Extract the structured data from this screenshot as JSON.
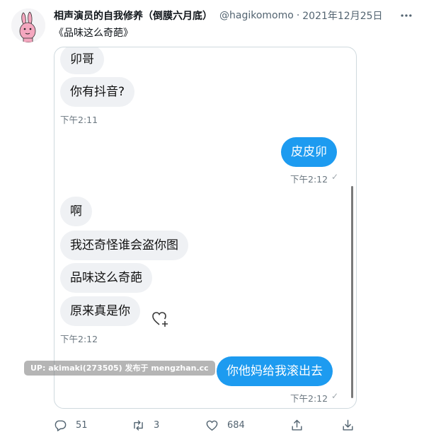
{
  "author": {
    "display_name": "相声演员的自我修养（倒膜六月底）",
    "handle": "@hagikomomo",
    "separator": "·",
    "date": "2021年12月25日"
  },
  "tweet": {
    "text": "《品味这么奇葩》"
  },
  "chat": {
    "messages": [
      {
        "direction": "in",
        "text": "卯哥"
      },
      {
        "direction": "in",
        "text": "你有抖音?"
      },
      {
        "type": "time",
        "text": "下午2:11"
      },
      {
        "direction": "out",
        "text": "皮皮卯"
      },
      {
        "type": "time",
        "text": "下午2:12",
        "read_mark": "✓"
      },
      {
        "direction": "in",
        "text": "啊"
      },
      {
        "direction": "in",
        "text": "我还奇怪谁会盗你图"
      },
      {
        "direction": "in",
        "text": "品味这么奇葩"
      },
      {
        "direction": "in",
        "text": "原来真是你"
      },
      {
        "type": "time",
        "text": "下午2:12"
      },
      {
        "direction": "out",
        "text": "你他妈给我滚出去"
      },
      {
        "type": "time",
        "text": "下午2:12",
        "read_mark": "✓"
      }
    ]
  },
  "watermark": "UP: akimaki(273505) 发布于 mengzhan.cc",
  "actions": {
    "reply_count": "51",
    "retweet_count": "3",
    "like_count": "684"
  },
  "icons": {
    "more": "more-icon",
    "reply": "reply-icon",
    "retweet": "retweet-icon",
    "like": "heart-icon",
    "share": "share-icon",
    "download": "download-icon"
  },
  "colors": {
    "accent": "#1d9bf0",
    "incoming_bubble": "#eff1f4",
    "secondary_text": "#536471",
    "avatar_pink": "#f4a7bf"
  }
}
